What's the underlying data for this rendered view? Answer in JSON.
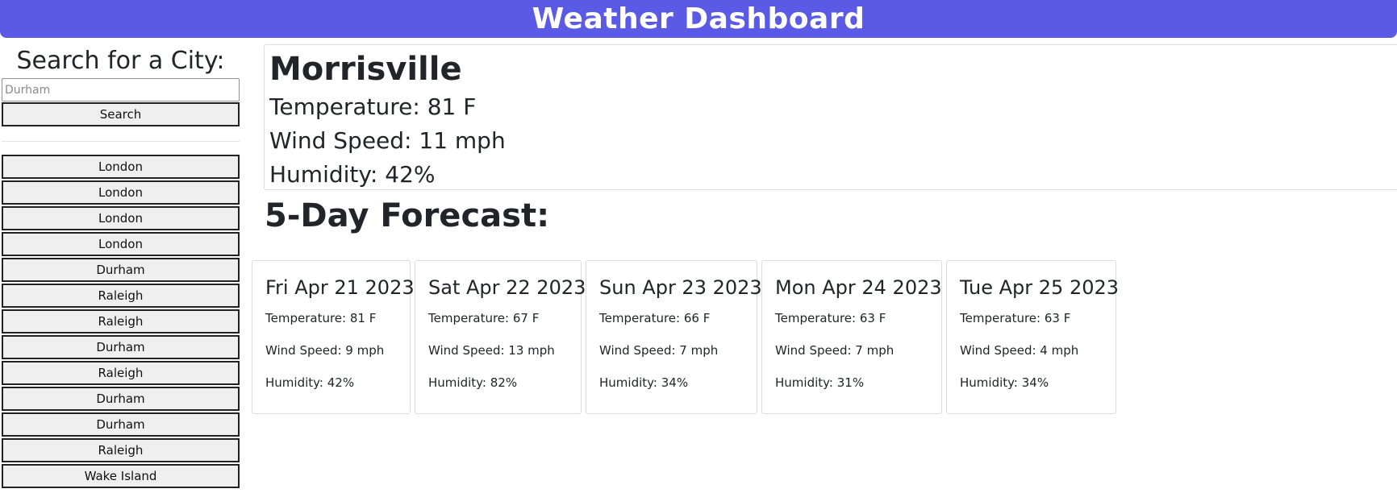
{
  "header": {
    "title": "Weather Dashboard"
  },
  "sidebar": {
    "heading": "Search for a City:",
    "search_placeholder": "Durham",
    "search_value": "",
    "search_button": "Search",
    "history": [
      "London",
      "London",
      "London",
      "London",
      "Durham",
      "Raleigh",
      "Raleigh",
      "Durham",
      "Raleigh",
      "Durham",
      "Durham",
      "Raleigh",
      "Wake Island"
    ]
  },
  "current": {
    "city": "Morrisville",
    "temperature": "Temperature: 81 F",
    "wind": "Wind Speed: 11 mph",
    "humidity": "Humidity: 42%"
  },
  "forecast": {
    "title": "5-Day Forecast:",
    "days": [
      {
        "date": "Fri Apr 21 2023",
        "temperature": "Temperature: 81 F",
        "wind": "Wind Speed: 9 mph",
        "humidity": "Humidity: 42%"
      },
      {
        "date": "Sat Apr 22 2023",
        "temperature": "Temperature: 67 F",
        "wind": "Wind Speed: 13 mph",
        "humidity": "Humidity: 82%"
      },
      {
        "date": "Sun Apr 23 2023",
        "temperature": "Temperature: 66 F",
        "wind": "Wind Speed: 7 mph",
        "humidity": "Humidity: 34%"
      },
      {
        "date": "Mon Apr 24 2023",
        "temperature": "Temperature: 63 F",
        "wind": "Wind Speed: 7 mph",
        "humidity": "Humidity: 31%"
      },
      {
        "date": "Tue Apr 25 2023",
        "temperature": "Temperature: 63 F",
        "wind": "Wind Speed: 4 mph",
        "humidity": "Humidity: 34%"
      }
    ]
  },
  "colors": {
    "header_bg": "#5a5ae6",
    "header_text": "#ffffff"
  }
}
